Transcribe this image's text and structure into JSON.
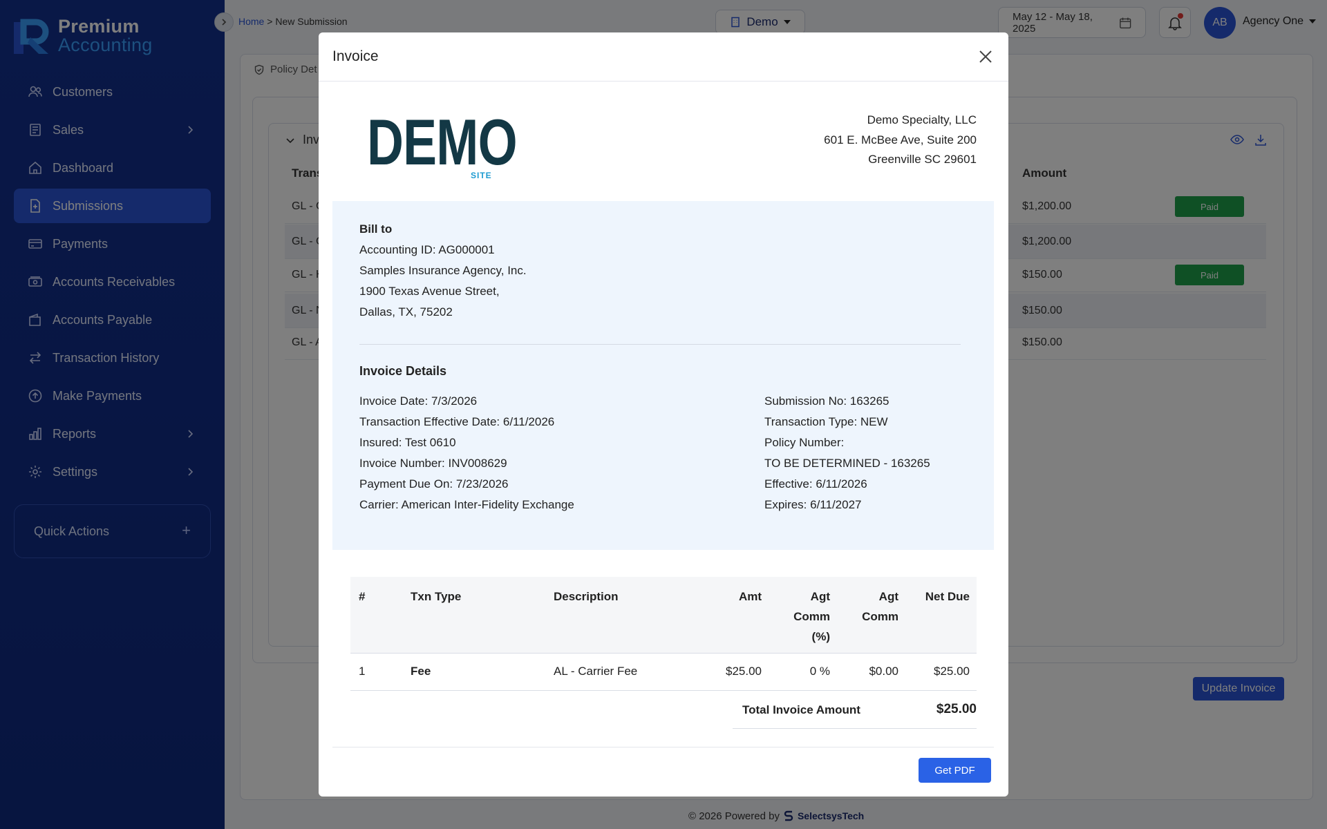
{
  "sidebar": {
    "logo_line1": "Premium",
    "logo_line2": "Accounting",
    "items": [
      {
        "label": "Customers",
        "icon": "users-icon"
      },
      {
        "label": "Sales",
        "icon": "receipt-icon"
      },
      {
        "label": "Dashboard",
        "icon": "home-icon"
      },
      {
        "label": "Submissions",
        "icon": "file-plus-icon",
        "active": true
      },
      {
        "label": "Payments",
        "icon": "card-icon"
      },
      {
        "label": "Accounts Receivables",
        "icon": "cash-icon"
      },
      {
        "label": "Accounts Payable",
        "icon": "wallet-icon"
      },
      {
        "label": "Transaction History",
        "icon": "arrows-icon"
      },
      {
        "label": "Make Payments",
        "icon": "upload-circle-icon"
      },
      {
        "label": "Reports",
        "icon": "bar-chart-icon"
      },
      {
        "label": "Settings",
        "icon": "gear-icon"
      }
    ],
    "quick_actions": "Quick Actions"
  },
  "topbar": {
    "breadcrumb_home": "Home",
    "breadcrumb_sep": ">",
    "breadcrumb_current": "New Submission",
    "org": "Demo",
    "date_range": "May 12 - May 18, 2025",
    "avatar_initials": "AB",
    "user": "Agency One"
  },
  "background": {
    "tab_label": "Policy Det",
    "section_title": "Inv",
    "col_trans": "Trans",
    "col_amount": "Amount",
    "rows": [
      {
        "type": "GL - C",
        "amount": "$1,200.00",
        "status": "Paid"
      },
      {
        "type": "GL - C",
        "amount": "$1,200.00",
        "status": ""
      },
      {
        "type": "GL - H",
        "amount": "$150.00",
        "status": "Paid"
      },
      {
        "type": "GL - N",
        "amount": "$150.00",
        "status": ""
      },
      {
        "type": "GL - A",
        "amount": "$150.00",
        "status": ""
      }
    ],
    "update_button": "Update Invoice",
    "footer_text": "© 2026 Powered by",
    "footer_brand": "SelectsysTech"
  },
  "modal": {
    "title": "Invoice",
    "logo_text": "DEMO",
    "logo_sub": "SITE",
    "company": {
      "name": "Demo Specialty, LLC",
      "address1": "601 E. McBee Ave, Suite 200",
      "address2": "Greenville SC 29601"
    },
    "bill_to": {
      "heading": "Bill to",
      "accounting_id": "Accounting ID: AG000001",
      "name": "Samples Insurance Agency, Inc.",
      "street": "1900 Texas Avenue Street,",
      "city": "Dallas, TX, 75202"
    },
    "details": {
      "heading": "Invoice Details",
      "left": [
        "Invoice Date: 7/3/2026",
        "Transaction Effective Date: 6/11/2026",
        "Insured: Test 0610",
        "Invoice Number: INV008629",
        "Payment Due On: 7/23/2026",
        "Carrier: American Inter-Fidelity Exchange"
      ],
      "right": [
        "Submission No: 163265",
        "Transaction Type: NEW",
        "Policy Number:",
        "TO BE DETERMINED - 163265",
        "Effective: 6/11/2026",
        "Expires: 6/11/2027"
      ]
    },
    "table": {
      "headers": {
        "num": "#",
        "txn_type": "Txn Type",
        "description": "Description",
        "amt": "Amt",
        "agt_comm_pct_1": "Agt",
        "agt_comm_pct_2": "Comm",
        "agt_comm_pct_3": "(%)",
        "agt_comm_1": "Agt",
        "agt_comm_2": "Comm",
        "net_due": "Net Due"
      },
      "rows": [
        {
          "num": "1",
          "txn_type": "Fee",
          "description": "AL - Carrier Fee",
          "amt": "$25.00",
          "agt_comm_pct": "0 %",
          "agt_comm": "$0.00",
          "net_due": "$25.00"
        }
      ],
      "total_label": "Total Invoice Amount",
      "total_value": "$25.00"
    },
    "pdf_button": "Get PDF"
  }
}
